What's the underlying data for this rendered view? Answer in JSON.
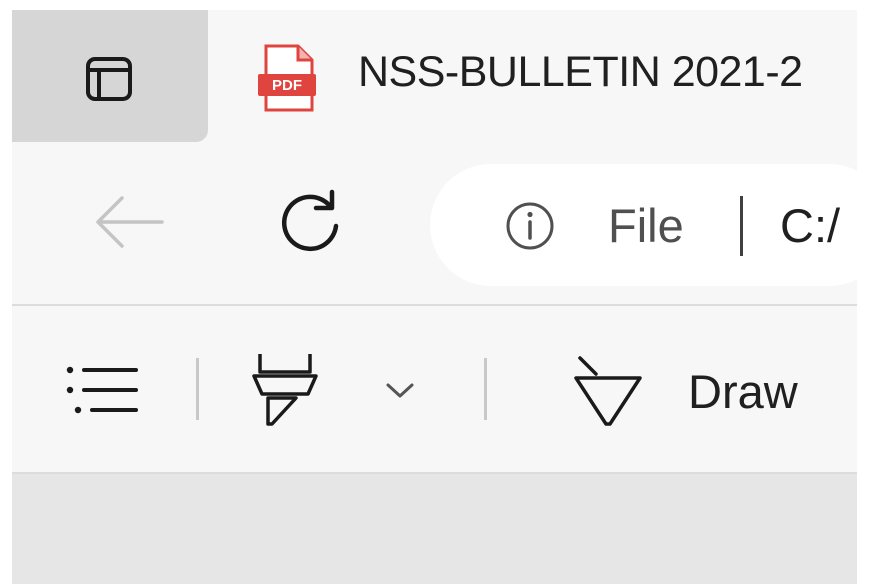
{
  "tab": {
    "title": "NSS-BULLETIN 2021-2",
    "icon_badge": "PDF"
  },
  "address_bar": {
    "scheme_label": "File",
    "url": "C:/"
  },
  "pdf_toolbar": {
    "draw_label": "Draw"
  },
  "icons": {
    "tab_actions": "tab-actions-icon",
    "pdf": "pdf-file-icon",
    "back": "back-arrow-icon",
    "refresh": "refresh-icon",
    "info": "info-icon",
    "contents": "table-of-contents-icon",
    "highlight": "highlighter-icon",
    "highlight_menu": "chevron-down-icon",
    "draw": "draw-pen-icon"
  },
  "colors": {
    "pdf_red": "#e0443e",
    "tab_actions_bg": "#d6d6d6",
    "chrome_bg": "#f7f7f7",
    "content_bg": "#e6e6e6"
  }
}
